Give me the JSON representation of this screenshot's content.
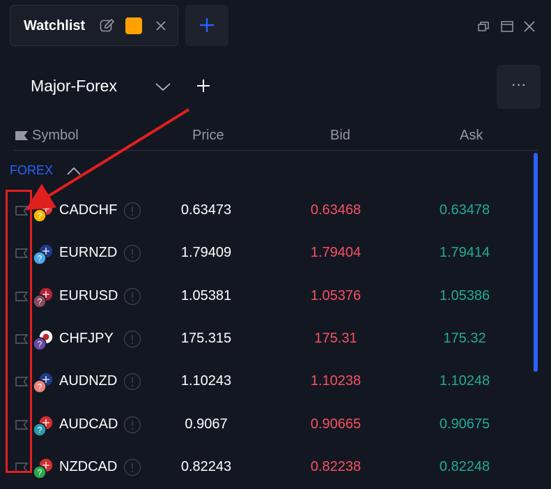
{
  "tab": {
    "title": "Watchlist",
    "color": "#ffa200"
  },
  "watchlist": {
    "name": "Major-Forex"
  },
  "more_label": "···",
  "columns": {
    "symbol": "Symbol",
    "price": "Price",
    "bid": "Bid",
    "ask": "Ask"
  },
  "group": {
    "name": "FOREX"
  },
  "colors": {
    "accent": "#2962ff",
    "bid": "#f7525f",
    "ask": "#22ab94",
    "annotation": "#e01f1f"
  },
  "rows": [
    {
      "symbol": "CADCHF",
      "price": "0.63473",
      "bid": "0.63468",
      "ask": "0.63478",
      "icon": "canada-swiss-flag-icon"
    },
    {
      "symbol": "EURNZD",
      "price": "1.79409",
      "bid": "1.79404",
      "ask": "1.79414",
      "icon": "eu-nz-flag-icon"
    },
    {
      "symbol": "EURUSD",
      "price": "1.05381",
      "bid": "1.05376",
      "ask": "1.05386",
      "icon": "eu-us-flag-icon"
    },
    {
      "symbol": "CHFJPY",
      "price": "175.315",
      "bid": "175.31",
      "ask": "175.32",
      "icon": "swiss-japan-flag-icon"
    },
    {
      "symbol": "AUDNZD",
      "price": "1.10243",
      "bid": "1.10238",
      "ask": "1.10248",
      "icon": "au-nz-flag-icon"
    },
    {
      "symbol": "AUDCAD",
      "price": "0.9067",
      "bid": "0.90665",
      "ask": "0.90675",
      "icon": "au-canada-flag-icon"
    },
    {
      "symbol": "NZDCAD",
      "price": "0.82243",
      "bid": "0.82238",
      "ask": "0.82248",
      "icon": "nz-canada-flag-icon"
    }
  ]
}
